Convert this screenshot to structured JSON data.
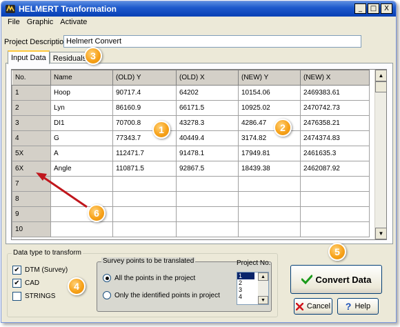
{
  "window": {
    "title": "HELMERT Tranformation",
    "min_label": "_",
    "max_label": "□",
    "close_label": "X"
  },
  "menu": [
    "File",
    "Graphic",
    "Activate"
  ],
  "project": {
    "label": "Project Description",
    "value": "Helmert Convert"
  },
  "tabs": [
    "Input Data",
    "Residuals"
  ],
  "grid": {
    "columns": [
      "No.",
      "Name",
      "(OLD) Y",
      "(OLD) X",
      "(NEW) Y",
      "(NEW) X"
    ],
    "rows": [
      [
        "1",
        "Hoop",
        "90717.4",
        "64202",
        "10154.06",
        "2469383.61"
      ],
      [
        "2",
        "Lyn",
        "86160.9",
        "66171.5",
        "10925.02",
        "2470742.73"
      ],
      [
        "3",
        "DI1",
        "70700.8",
        "43278.3",
        "4286.47",
        "2476358.21"
      ],
      [
        "4",
        "G",
        "77343.7",
        "40449.4",
        "3174.82",
        "2474374.83"
      ],
      [
        "5X",
        "A",
        "112471.7",
        "91478.1",
        "17949.81",
        "2461635.3"
      ],
      [
        "6X",
        "Angle",
        "110871.5",
        "92867.5",
        "18439.38",
        "2462087.92"
      ],
      [
        "7",
        "",
        "",
        "",
        "",
        ""
      ],
      [
        "8",
        "",
        "",
        "",
        "",
        ""
      ],
      [
        "9",
        "",
        "",
        "",
        "",
        ""
      ],
      [
        "10",
        "",
        "",
        "",
        "",
        ""
      ]
    ]
  },
  "data_type": {
    "title": "Data type to transform",
    "options": [
      {
        "label": "DTM (Survey)",
        "checked": true
      },
      {
        "label": "CAD",
        "checked": true
      },
      {
        "label": "STRINGS",
        "checked": false
      }
    ]
  },
  "survey": {
    "title": "Survey points to be translated",
    "options": [
      {
        "label": "All the points in the project",
        "selected": true
      },
      {
        "label": "Only the identified points in project",
        "selected": false
      }
    ]
  },
  "project_no": {
    "title": "Project No.",
    "items": [
      "1",
      "2",
      "3",
      "4"
    ],
    "selected": "1"
  },
  "buttons": {
    "convert": "Convert Data",
    "cancel": "Cancel",
    "help": "Help"
  },
  "callouts": [
    "1",
    "2",
    "3",
    "4",
    "5",
    "6"
  ],
  "colors": {
    "callout": "#f7a21a",
    "arrow": "#c0161c",
    "titlebar": "#0b43b8",
    "selection": "#0a246a"
  }
}
